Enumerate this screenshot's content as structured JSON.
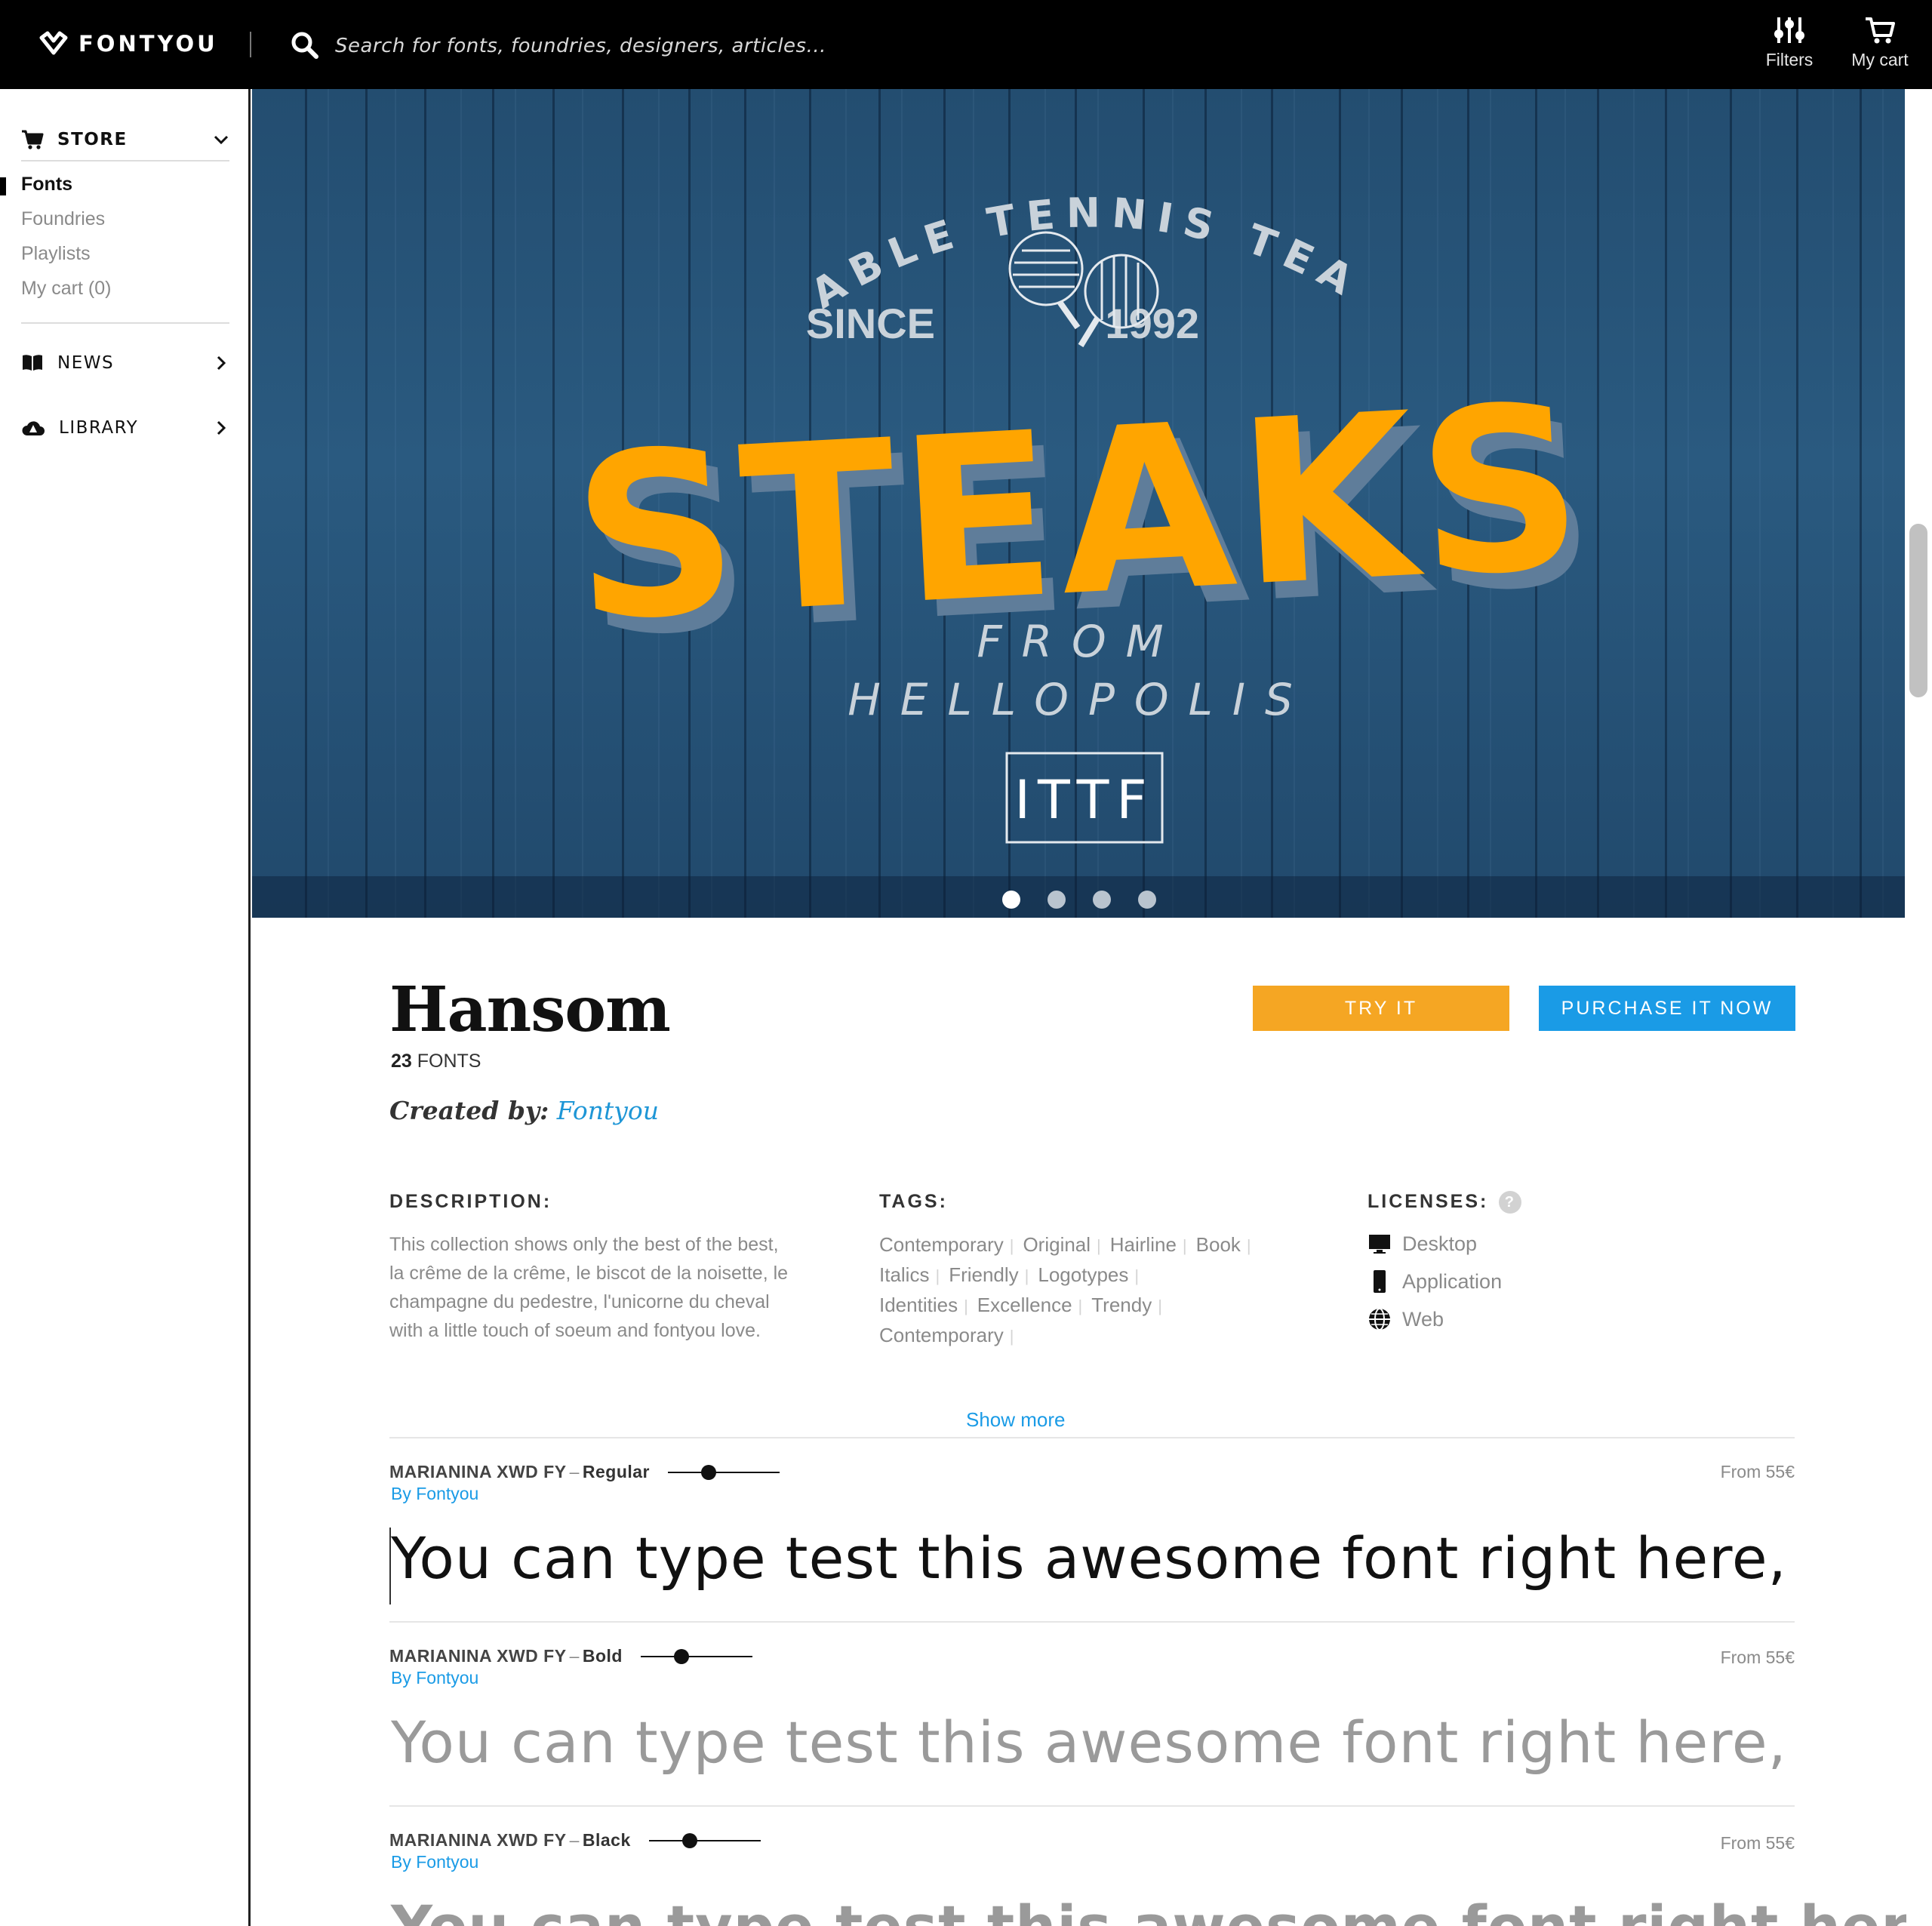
{
  "app": {
    "logo_text": "FONTYOU",
    "search_placeholder": "Search for fonts, foundries, designers, articles...",
    "filters_label": "Filters",
    "cart_label": "My cart"
  },
  "sidebar": {
    "store_label": "STORE",
    "store_items": [
      {
        "label": "Fonts",
        "active": true
      },
      {
        "label": "Foundries"
      },
      {
        "label": "Playlists"
      },
      {
        "label": "My cart (0)"
      }
    ],
    "news_label": "NEWS",
    "library_label": "LIBRARY"
  },
  "hero": {
    "arc_text": "TABLE TENNIS TEAM",
    "since_label": "SINCE",
    "year": "1992",
    "headline": "STEAKS",
    "from_label": "FROM",
    "city": "HELLOPOLIS",
    "badge": "ITTF",
    "slide_count": 4,
    "active_slide": 1,
    "colors": {
      "headline": "#ffa500",
      "background": "#234d70"
    }
  },
  "font": {
    "name": "Hansom",
    "count_number": "23",
    "count_label": "FONTS",
    "created_by_label": "Created by:",
    "creator": "Fontyou",
    "try_label": "TRY IT",
    "purchase_label": "PURCHASE IT NOW",
    "description_heading": "DESCRIPTION:",
    "description": "This collection shows only the best of the best, la crême de la crême, le biscot de la noisette, le champagne du pedestre, l'unicorne du cheval with a little touch of soeum and fontyou love.",
    "tags_heading": "TAGS:",
    "tag_rows": [
      [
        "Contemporary",
        "Original",
        "Hairline",
        "Book"
      ],
      [
        "Italics",
        "Friendly",
        "Logotypes"
      ],
      [
        "Identities",
        "Excellence",
        "Trendy"
      ],
      [
        "Contemporary"
      ]
    ],
    "licenses_heading": "LICENSES:",
    "help_glyph": "?",
    "licenses": [
      {
        "label": "Desktop",
        "icon": "desktop-icon"
      },
      {
        "label": "Application",
        "icon": "phone-icon"
      },
      {
        "label": "Web",
        "icon": "globe-icon"
      }
    ],
    "show_more": "Show more"
  },
  "variants": [
    {
      "family": "MARIANINA XWD FY",
      "separator": "–",
      "weight": "Regular",
      "by": "By Fontyou",
      "price": "From 55€",
      "sample": "You can type test this awesome font right here,"
    },
    {
      "family": "MARIANINA XWD FY",
      "separator": "–",
      "weight": "Bold",
      "by": "By Fontyou",
      "price": "From 55€",
      "sample": "You can type test this awesome font right here,"
    },
    {
      "family": "MARIANINA XWD FY",
      "separator": "–",
      "weight": "Black",
      "by": "By Fontyou",
      "price": "From 55€",
      "sample": "You can type test this awesome font right her"
    }
  ]
}
